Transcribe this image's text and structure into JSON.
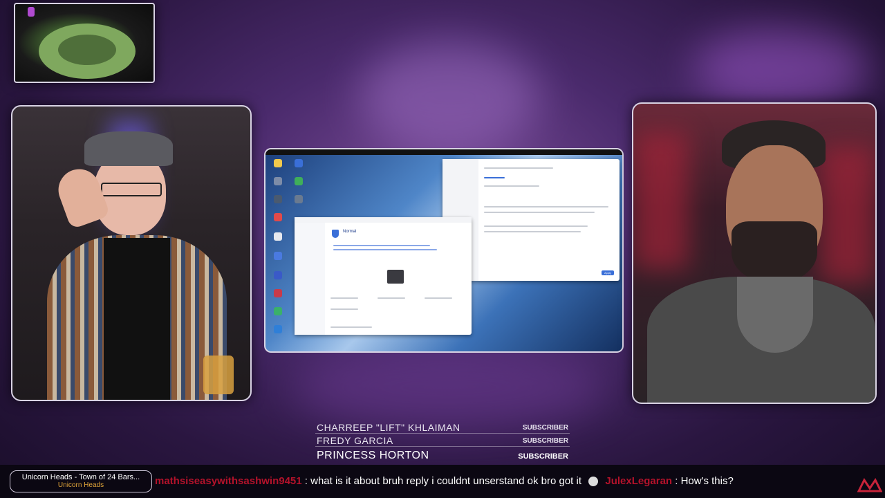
{
  "credits": [
    {
      "name": "CHARREEP \"LIFT\" KHLAIMAN",
      "tag": "SUBSCRIBER"
    },
    {
      "name": "FREDY GARCIA",
      "tag": "SUBSCRIBER"
    },
    {
      "name": "PRINCESS HORTON",
      "tag": "SUBSCRIBER"
    }
  ],
  "now_playing": {
    "title": "Unicorn Heads - Town of 24 Bars...",
    "artist": "Unicorn Heads"
  },
  "chat": [
    {
      "user": "mathsiseasywithsashwin9451",
      "message": "what is it about  bruh reply i couldnt unserstand  ok bro got it"
    },
    {
      "user": "JulexLegaran",
      "message": "How's this?"
    }
  ],
  "screen": {
    "storage_window": {
      "status": "Normal"
    },
    "control_panel": {
      "apply_button": "Apply"
    }
  },
  "colors": {
    "accent": "#e2a63a",
    "chat_user": "#b3122a"
  }
}
